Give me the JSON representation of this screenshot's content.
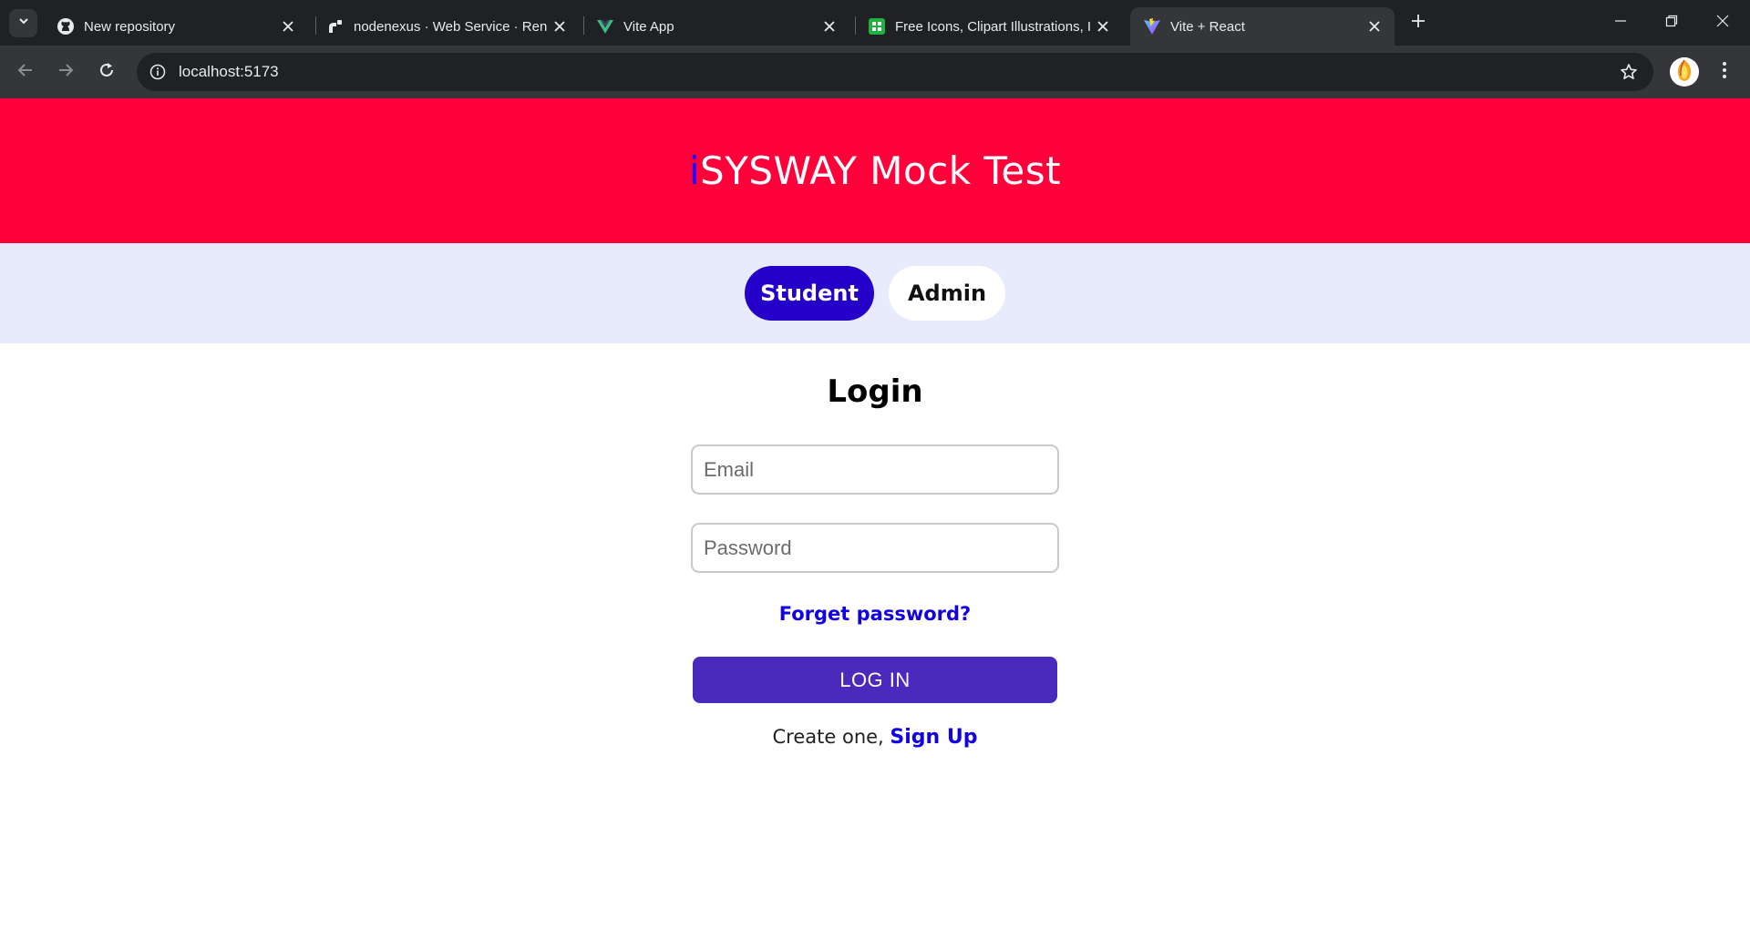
{
  "browser": {
    "tabs": [
      {
        "title": "New repository",
        "favicon": "github-icon"
      },
      {
        "title": "nodenexus · Web Service · Ren",
        "favicon": "render-icon"
      },
      {
        "title": "Vite App",
        "favicon": "vue-icon"
      },
      {
        "title": "Free Icons, Clipart Illustrations, I",
        "favicon": "icons8-icon"
      },
      {
        "title": "Vite + React",
        "favicon": "vite-icon",
        "active": true
      }
    ],
    "url": "localhost:5173",
    "colors": {
      "tabstrip": "#202124",
      "toolbar": "#35363a",
      "omnibox": "#202124"
    }
  },
  "header": {
    "title_accent": "i",
    "title_rest": "SYSWAY Mock Test",
    "background": "#ff003b",
    "accent_color": "#1a00ff"
  },
  "roles": {
    "student_label": "Student",
    "admin_label": "Admin",
    "selected": "Student",
    "background": "#e7ebfc"
  },
  "login": {
    "heading": "Login",
    "email_placeholder": "Email",
    "email_value": "",
    "password_placeholder": "Password",
    "password_value": "",
    "forgot_label": "Forget password?",
    "submit_label": "LOG IN",
    "signup_prefix": "Create one, ",
    "signup_link": "Sign Up",
    "button_color": "#4a29bd",
    "link_color": "#1100e6"
  }
}
